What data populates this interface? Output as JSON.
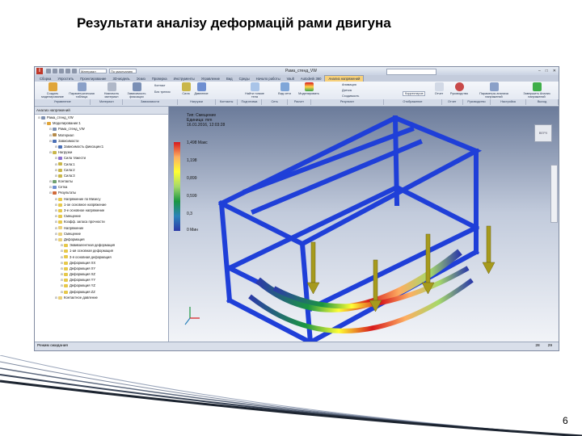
{
  "slide": {
    "title": "Результати аналізу деформацій рами двигуна",
    "page_number": "6"
  },
  "app": {
    "window_title": "Рама_стенд_VW",
    "quick_access_field_1": "Материал",
    "quick_access_field_2": "По умолчанию",
    "tabs": [
      "Сборка",
      "Упростить",
      "Проектирование",
      "3D-модель",
      "Эскиз",
      "Проверка",
      "Инструменты",
      "Управление",
      "Вид",
      "Среды",
      "Начало работы",
      "Vault",
      "Autodesk 360",
      "Анализ напряжений"
    ],
    "active_tab_index": 13,
    "ribbon": {
      "buttons": [
        {
          "label": "Создать моделирование"
        },
        {
          "label": "Параметрическая таблица"
        },
        {
          "label": "Назначить материал"
        },
        {
          "label": "Зависимость фиксации"
        },
        {
          "label": "Сила"
        },
        {
          "label": "Давление"
        },
        {
          "label": "Найти тонкие тела"
        },
        {
          "label": "Вид сети"
        },
        {
          "label": "Моделировать"
        },
        {
          "label": "Отчет"
        },
        {
          "label": "Руководство"
        },
        {
          "label": "Параметры анализа напряжений"
        },
        {
          "label": "Завершить Анализ напряжений"
        }
      ],
      "small_items": [
        "Контакт",
        "Без трения",
        "Анимация",
        "Датчик",
        "Сходимость",
        "Корректиров"
      ],
      "panels": [
        "Управление",
        "Материал",
        "Зависимости",
        "Нагрузки",
        "Контакты",
        "Подготовка",
        "Сеть",
        "Расчет",
        "Результат",
        "Отображение",
        "Отчет",
        "Руководство",
        "Настройка",
        "Выход"
      ]
    },
    "browser": {
      "header": "Анализ напряжений",
      "tree": [
        {
          "label": "Рама_стенд_VW",
          "level": 0,
          "icon": "assembly"
        },
        {
          "label": "Моделирование:1",
          "level": 1,
          "icon": "sim"
        },
        {
          "label": "Рама_стенд_VW",
          "level": 2,
          "icon": "assembly"
        },
        {
          "label": "Материал",
          "level": 2,
          "icon": "material"
        },
        {
          "label": "Зависимости",
          "level": 2,
          "icon": "constraint"
        },
        {
          "label": "Зависимость фиксации:1",
          "level": 3,
          "icon": "constraint"
        },
        {
          "label": "Нагрузки",
          "level": 2,
          "icon": "load"
        },
        {
          "label": "Сила тяжести",
          "level": 3,
          "icon": "gravity"
        },
        {
          "label": "Сила:1",
          "level": 3,
          "icon": "force"
        },
        {
          "label": "Сила:2",
          "level": 3,
          "icon": "force"
        },
        {
          "label": "Сила:3",
          "level": 3,
          "icon": "force"
        },
        {
          "label": "Контакты",
          "level": 2,
          "icon": "contact"
        },
        {
          "label": "Сетка",
          "level": 2,
          "icon": "mesh"
        },
        {
          "label": "Результаты",
          "level": 2,
          "icon": "results"
        },
        {
          "label": "Напряжение по Мизесу",
          "level": 3,
          "icon": "result"
        },
        {
          "label": "1-ое основное напряжение",
          "level": 3,
          "icon": "result"
        },
        {
          "label": "3-е основное напряжение",
          "level": 3,
          "icon": "result"
        },
        {
          "label": "Смещение",
          "level": 3,
          "icon": "result"
        },
        {
          "label": "Коэфф. запаса прочности",
          "level": 3,
          "icon": "result"
        },
        {
          "label": "Напряжение",
          "level": 3,
          "icon": "folder"
        },
        {
          "label": "Смещение",
          "level": 3,
          "icon": "folder"
        },
        {
          "label": "Деформация",
          "level": 3,
          "icon": "folder"
        },
        {
          "label": "Эквивалентная деформация",
          "level": 4,
          "icon": "result"
        },
        {
          "label": "1-ая основная деформация",
          "level": 4,
          "icon": "result"
        },
        {
          "label": "3-я основная деформация",
          "level": 4,
          "icon": "result"
        },
        {
          "label": "Деформация XX",
          "level": 4,
          "icon": "result"
        },
        {
          "label": "Деформация XY",
          "level": 4,
          "icon": "result"
        },
        {
          "label": "Деформация XZ",
          "level": 4,
          "icon": "result"
        },
        {
          "label": "Деформация YY",
          "level": 4,
          "icon": "result"
        },
        {
          "label": "Деформация YZ",
          "level": 4,
          "icon": "result"
        },
        {
          "label": "Деформация ZZ",
          "level": 4,
          "icon": "result"
        },
        {
          "label": "Контактное давление",
          "level": 3,
          "icon": "folder"
        }
      ]
    },
    "viewport": {
      "info_type": "Тип: Смещение",
      "info_unit": "Единица: mm",
      "info_date": "16.01.2016, 12:03:28",
      "legend_values": [
        "1,498 Макс",
        "1,198",
        "0,899",
        "0,599",
        "0,3",
        "0 Мин"
      ],
      "cube_label": "ВЕРХ"
    },
    "status": {
      "text": "Режим ожидания",
      "num1": "28",
      "num2": "29"
    }
  },
  "colors": {
    "frame": "#1f3fd8",
    "max": "#d7191c",
    "min": "#2c3aa8",
    "force_arrow": "#a69a1c"
  }
}
